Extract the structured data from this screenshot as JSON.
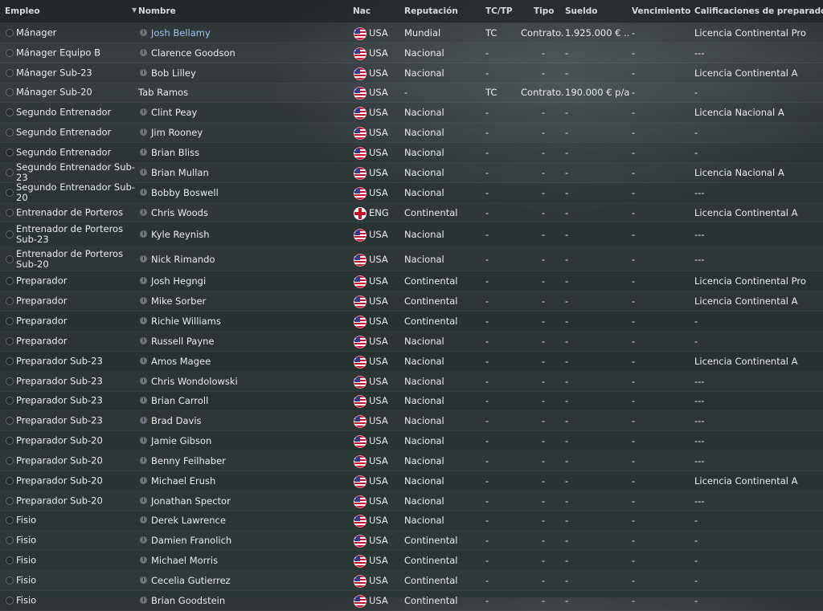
{
  "headers": {
    "empleo": "Empleo",
    "nombre": "Nombre",
    "nac": "Nac",
    "reputacion": "Reputación",
    "tctp": "TC/TP",
    "tipo": "Tipo",
    "sueldo": "Sueldo",
    "vencimiento": "Vencimiento",
    "calificaciones": "Calificaciones de preparador"
  },
  "rows": [
    {
      "job": "Mánager",
      "name": "Josh Bellamy",
      "nat": "USA",
      "rep": "Mundial",
      "tc": "TC",
      "tipo": "Contrato...",
      "sueldo": "1.925.000 € ...",
      "venc": "-",
      "cal": "Licencia Continental Pro"
    },
    {
      "job": "Mánager Equipo B",
      "name": "Clarence Goodson",
      "nat": "USA",
      "rep": "Nacional",
      "tc": "-",
      "tipo": "-",
      "sueldo": "-",
      "venc": "-",
      "cal": "---"
    },
    {
      "job": "Mánager Sub-23",
      "name": "Bob Lilley",
      "nat": "USA",
      "rep": "Nacional",
      "tc": "-",
      "tipo": "-",
      "sueldo": "-",
      "venc": "-",
      "cal": "Licencia Continental A"
    },
    {
      "job": "Mánager Sub-20",
      "name": "Tab Ramos",
      "nat": "USA",
      "rep": "-",
      "tc": "TC",
      "tipo": "Contrato...",
      "sueldo": "190.000 € p/a",
      "venc": "-",
      "cal": "-"
    },
    {
      "job": "Segundo Entrenador",
      "name": "Clint Peay",
      "nat": "USA",
      "rep": "Nacional",
      "tc": "-",
      "tipo": "-",
      "sueldo": "-",
      "venc": "-",
      "cal": "Licencia Nacional A"
    },
    {
      "job": "Segundo Entrenador",
      "name": "Jim Rooney",
      "nat": "USA",
      "rep": "Nacional",
      "tc": "-",
      "tipo": "-",
      "sueldo": "-",
      "venc": "-",
      "cal": "-"
    },
    {
      "job": "Segundo Entrenador",
      "name": "Brian Bliss",
      "nat": "USA",
      "rep": "Nacional",
      "tc": "-",
      "tipo": "-",
      "sueldo": "-",
      "venc": "-",
      "cal": "-"
    },
    {
      "job": "Segundo Entrenador Sub-23",
      "name": "Brian Mullan",
      "nat": "USA",
      "rep": "Nacional",
      "tc": "-",
      "tipo": "-",
      "sueldo": "-",
      "venc": "-",
      "cal": "Licencia Nacional A"
    },
    {
      "job": "Segundo Entrenador Sub-20",
      "name": "Bobby Boswell",
      "nat": "USA",
      "rep": "Nacional",
      "tc": "-",
      "tipo": "-",
      "sueldo": "-",
      "venc": "-",
      "cal": "---"
    },
    {
      "job": "Entrenador de Porteros",
      "name": "Chris Woods",
      "nat": "ENG",
      "rep": "Continental",
      "tc": "-",
      "tipo": "-",
      "sueldo": "-",
      "venc": "-",
      "cal": "Licencia Continental A"
    },
    {
      "job": "Entrenador de Porteros Sub-23",
      "name": "Kyle Reynish",
      "nat": "USA",
      "rep": "Nacional",
      "tc": "-",
      "tipo": "-",
      "sueldo": "-",
      "venc": "-",
      "cal": "---"
    },
    {
      "job": "Entrenador de Porteros Sub-20",
      "name": "Nick Rimando",
      "nat": "USA",
      "rep": "Nacional",
      "tc": "-",
      "tipo": "-",
      "sueldo": "-",
      "venc": "-",
      "cal": "---"
    },
    {
      "job": "Preparador",
      "name": "Josh Hegngi",
      "nat": "USA",
      "rep": "Continental",
      "tc": "-",
      "tipo": "-",
      "sueldo": "-",
      "venc": "-",
      "cal": "Licencia Continental Pro"
    },
    {
      "job": "Preparador",
      "name": "Mike Sorber",
      "nat": "USA",
      "rep": "Continental",
      "tc": "-",
      "tipo": "-",
      "sueldo": "-",
      "venc": "-",
      "cal": "Licencia Continental A"
    },
    {
      "job": "Preparador",
      "name": "Richie Williams",
      "nat": "USA",
      "rep": "Continental",
      "tc": "-",
      "tipo": "-",
      "sueldo": "-",
      "venc": "-",
      "cal": "-"
    },
    {
      "job": "Preparador",
      "name": "Russell Payne",
      "nat": "USA",
      "rep": "Nacional",
      "tc": "-",
      "tipo": "-",
      "sueldo": "-",
      "venc": "-",
      "cal": "-"
    },
    {
      "job": "Preparador Sub-23",
      "name": "Amos Magee",
      "nat": "USA",
      "rep": "Nacional",
      "tc": "-",
      "tipo": "-",
      "sueldo": "-",
      "venc": "-",
      "cal": "Licencia Continental A"
    },
    {
      "job": "Preparador Sub-23",
      "name": "Chris Wondolowski",
      "nat": "USA",
      "rep": "Nacional",
      "tc": "-",
      "tipo": "-",
      "sueldo": "-",
      "venc": "-",
      "cal": "---"
    },
    {
      "job": "Preparador Sub-23",
      "name": "Brian Carroll",
      "nat": "USA",
      "rep": "Nacional",
      "tc": "-",
      "tipo": "-",
      "sueldo": "-",
      "venc": "-",
      "cal": "---"
    },
    {
      "job": "Preparador Sub-23",
      "name": "Brad Davis",
      "nat": "USA",
      "rep": "Nacional",
      "tc": "-",
      "tipo": "-",
      "sueldo": "-",
      "venc": "-",
      "cal": "---"
    },
    {
      "job": "Preparador Sub-20",
      "name": "Jamie Gibson",
      "nat": "USA",
      "rep": "Nacional",
      "tc": "-",
      "tipo": "-",
      "sueldo": "-",
      "venc": "-",
      "cal": "---"
    },
    {
      "job": "Preparador Sub-20",
      "name": "Benny Feilhaber",
      "nat": "USA",
      "rep": "Nacional",
      "tc": "-",
      "tipo": "-",
      "sueldo": "-",
      "venc": "-",
      "cal": "---"
    },
    {
      "job": "Preparador Sub-20",
      "name": "Michael Erush",
      "nat": "USA",
      "rep": "Nacional",
      "tc": "-",
      "tipo": "-",
      "sueldo": "-",
      "venc": "-",
      "cal": "Licencia Continental A"
    },
    {
      "job": "Preparador Sub-20",
      "name": "Jonathan Spector",
      "nat": "USA",
      "rep": "Nacional",
      "tc": "-",
      "tipo": "-",
      "sueldo": "-",
      "venc": "-",
      "cal": "---"
    },
    {
      "job": "Fisio",
      "name": "Derek Lawrence",
      "nat": "USA",
      "rep": "Nacional",
      "tc": "-",
      "tipo": "-",
      "sueldo": "-",
      "venc": "-",
      "cal": "-"
    },
    {
      "job": "Fisio",
      "name": "Damien Franolich",
      "nat": "USA",
      "rep": "Continental",
      "tc": "-",
      "tipo": "-",
      "sueldo": "-",
      "venc": "-",
      "cal": "-"
    },
    {
      "job": "Fisio",
      "name": "Michael Morris",
      "nat": "USA",
      "rep": "Continental",
      "tc": "-",
      "tipo": "-",
      "sueldo": "-",
      "venc": "-",
      "cal": "-"
    },
    {
      "job": "Fisio",
      "name": "Cecelia Gutierrez",
      "nat": "USA",
      "rep": "Continental",
      "tc": "-",
      "tipo": "-",
      "sueldo": "-",
      "venc": "-",
      "cal": "-"
    },
    {
      "job": "Fisio",
      "name": "Brian Goodstein",
      "nat": "USA",
      "rep": "Continental",
      "tc": "-",
      "tipo": "-",
      "sueldo": "-",
      "venc": "-",
      "cal": "-"
    }
  ]
}
